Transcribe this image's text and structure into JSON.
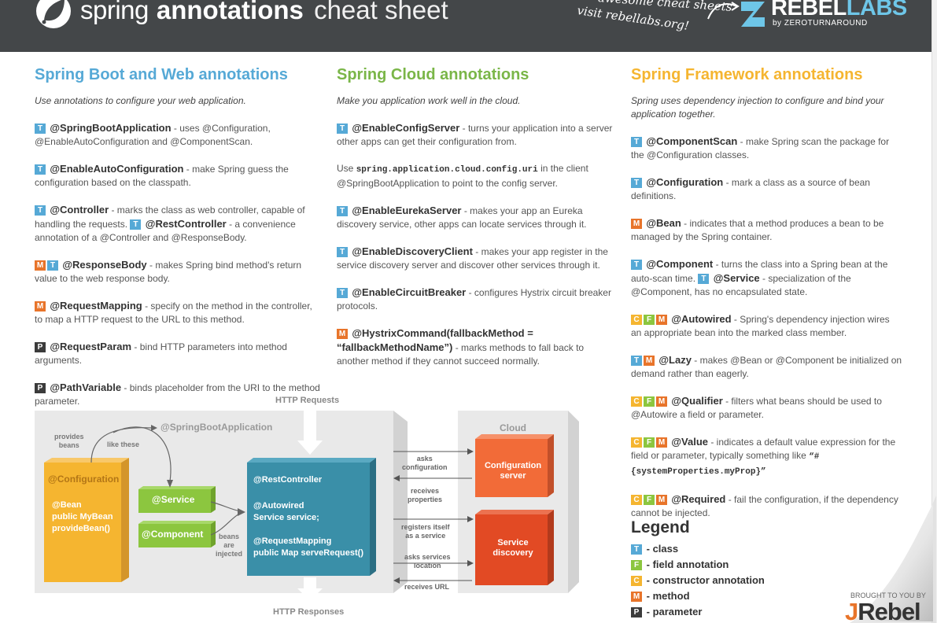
{
  "header": {
    "brand": "spring",
    "title_bold": "annotations",
    "title_rest": "cheat sheet",
    "promo_line1": "awesome cheat sheets",
    "promo_line2": "visit rebellabs.org!",
    "rebel": "REBEL",
    "labs": "LABS",
    "by_line": "by ZEROTURNAROUND"
  },
  "colors": {
    "blue": "#56a9d6",
    "green": "#7ab648",
    "yellow": "#f5b530",
    "orange": "#e8742a",
    "teal": "#3a8fa8",
    "header_bg": "#444749"
  },
  "columns": [
    {
      "title": "Spring Boot and Web annotations",
      "intro": "Use annotations to configure your web application.",
      "entries": [
        {
          "name": "@SpringBootApplication",
          "desc": " - uses @Configuration, @EnableAutoConfiguration and @ComponentScan."
        },
        {
          "name": "@EnableAutoConfiguration",
          "desc": " - make Spring guess the configuration based on the classpath."
        },
        {
          "name": "@Controller",
          "desc": " - marks the class as web controller, capable of handling the requests. ",
          "name2": "@RestController",
          "desc2": " - a convenience annotation of a @Controller and @ResponseBody."
        },
        {
          "name": "@ResponseBody",
          "desc": " - makes Spring bind method's return value to the web response body."
        },
        {
          "name": "@RequestMapping",
          "desc": " - specify on the method in the controller, to map a HTTP request to the URL to this method."
        },
        {
          "name": "@RequestParam",
          "desc": " - bind HTTP parameters into method arguments."
        },
        {
          "name": "@PathVariable",
          "desc": " - binds placeholder from the URI to the method parameter."
        }
      ]
    },
    {
      "title": "Spring Cloud annotations",
      "intro": "Make you application work well in the cloud.",
      "entries": [
        {
          "name": "@EnableConfigServer",
          "desc": " - turns your application into a server other apps can get their configuration from."
        },
        {
          "pre": "Use ",
          "code": "spring.application.cloud.config.uri",
          "desc": " in the client @SpringBootApplication to point to the config server."
        },
        {
          "name": "@EnableEurekaServer",
          "desc": " - makes your app an Eureka discovery service, other apps can locate services through it."
        },
        {
          "name": "@EnableDiscoveryClient",
          "desc": " - makes your app register in the service discovery server and discover other services through it."
        },
        {
          "name": "@EnableCircuitBreaker",
          "desc": " - configures Hystrix circuit breaker protocols."
        },
        {
          "name": "@HystrixCommand(fallbackMethod = “fallbackMethodName”)",
          "desc": " - marks methods to fall back to another method if they cannot succeed normally."
        }
      ]
    },
    {
      "title": "Spring Framework annotations",
      "intro": "Spring uses dependency injection to configure and bind your application together.",
      "entries": [
        {
          "name": "@ComponentScan",
          "desc": " - make Spring scan the package for the @Configuration classes."
        },
        {
          "name": "@Configuration",
          "desc": " - mark a class as a source of bean definitions."
        },
        {
          "name": "@Bean",
          "desc": " - indicates that a method produces a bean to be managed by the Spring container."
        },
        {
          "name": "@Component",
          "desc": " - turns the class into a Spring bean at the auto-scan time. ",
          "name2": "@Service",
          "desc2": " - specialization of the @Component, has no encapsulated state."
        },
        {
          "name": "@Autowired",
          "desc": " - Spring's dependency injection wires an appropriate bean into the marked class member."
        },
        {
          "name": "@Lazy",
          "desc": " - makes @Bean or @Component be initialized on demand rather than eagerly."
        },
        {
          "name": "@Qualifier",
          "desc": " - filters what beans should be used to @Autowire a field or parameter."
        },
        {
          "name": "@Value",
          "desc": " - indicates a default value expression for the field or parameter, typically something like ",
          "code": "“#{systemProperties.myProp}”"
        },
        {
          "name": "@Required",
          "desc": " - fail the configuration, if the dependency cannot be injected."
        }
      ]
    }
  ],
  "badges": {
    "T": "T",
    "F": "F",
    "C": "C",
    "M": "M",
    "P": "P"
  },
  "legend": {
    "title": "Legend",
    "items": [
      {
        "badge": "T",
        "label": "- class"
      },
      {
        "badge": "F",
        "label": "- field annotation"
      },
      {
        "badge": "C",
        "label": "- constructor annotation"
      },
      {
        "badge": "M",
        "label": "- method"
      },
      {
        "badge": "P",
        "label": "- parameter"
      }
    ]
  },
  "footer": {
    "brought": "BROUGHT TO YOU BY",
    "j": "J",
    "rebel": "Rebel"
  },
  "diagram": {
    "http_requests": "HTTP Requests",
    "http_responses": "HTTP Responses",
    "cloud": "Cloud",
    "sba": "@SpringBootApplication",
    "provides_beans": [
      "provides",
      "beans"
    ],
    "like_these": "like these",
    "config_box": {
      "title": "@Configuration",
      "lines": [
        "@Bean",
        "public MyBean",
        "provideBean()"
      ]
    },
    "service": "@Service",
    "component": "@Component",
    "beans_injected": [
      "beans",
      "are",
      "injected"
    ],
    "rest_box": {
      "title": "@RestController",
      "lines1": [
        "@Autowired",
        "Service service;"
      ],
      "lines2": [
        "@RequestMapping",
        "public Map serveRequest()"
      ]
    },
    "asks_configuration": [
      "asks",
      "configuration"
    ],
    "receives_properties": [
      "receives",
      "properties"
    ],
    "registers_itself": [
      "registers itself",
      "as a service"
    ],
    "asks_services": [
      "asks services",
      "location"
    ],
    "receives_url": "receives URL",
    "config_server": [
      "Configuration",
      "server"
    ],
    "service_discovery": [
      "Service",
      "discovery"
    ]
  }
}
